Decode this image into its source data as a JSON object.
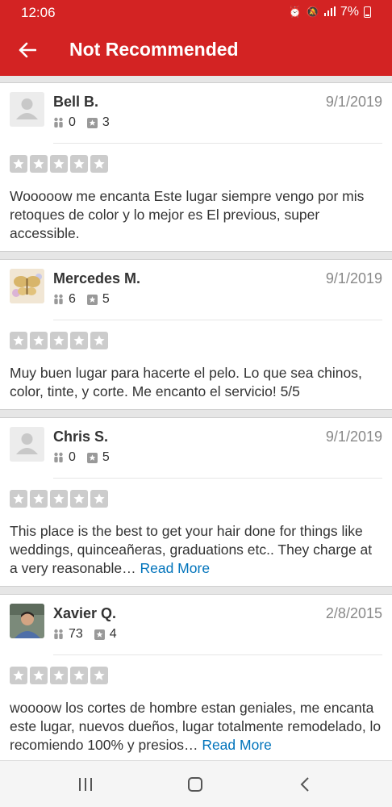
{
  "status_bar": {
    "time": "12:06",
    "battery": "7%"
  },
  "header": {
    "title": "Not Recommended"
  },
  "reviews": [
    {
      "name": "Bell B.",
      "date": "9/1/2019",
      "friends": "0",
      "reviews": "3",
      "text": "Wooooow me encanta Este lugar siempre vengo por mis retoques de color y lo mejor es El previous, super accessible.",
      "read_more": ""
    },
    {
      "name": "Mercedes M.",
      "date": "9/1/2019",
      "friends": "6",
      "reviews": "5",
      "text": "Muy buen lugar para hacerte el pelo. Lo que sea chinos, color, tinte, y corte. Me encanto el servicio! 5/5",
      "read_more": ""
    },
    {
      "name": "Chris S.",
      "date": "9/1/2019",
      "friends": "0",
      "reviews": "5",
      "text": "This place is the best to get your hair done for things like weddings, quinceañeras, graduations etc.. They charge at a very reasonable… ",
      "read_more": "Read More"
    },
    {
      "name": "Xavier Q.",
      "date": "2/8/2015",
      "friends": "73",
      "reviews": "4",
      "text": "woooow los cortes de hombre estan geniales, me encanta este lugar, nuevos dueños, lugar totalmente remodelado, lo recomiendo 100% y presios… ",
      "read_more": "Read More"
    }
  ],
  "icons": {
    "back": "arrow-left-icon",
    "friends": "friends-icon",
    "review_count": "star-badge-icon",
    "default_avatar": "default-user-icon",
    "nav": [
      "recent-apps-icon",
      "home-icon",
      "back-chevron-icon"
    ]
  },
  "colors": {
    "brand": "#d32323",
    "star_empty": "#cccccc",
    "link": "#0073bb"
  }
}
